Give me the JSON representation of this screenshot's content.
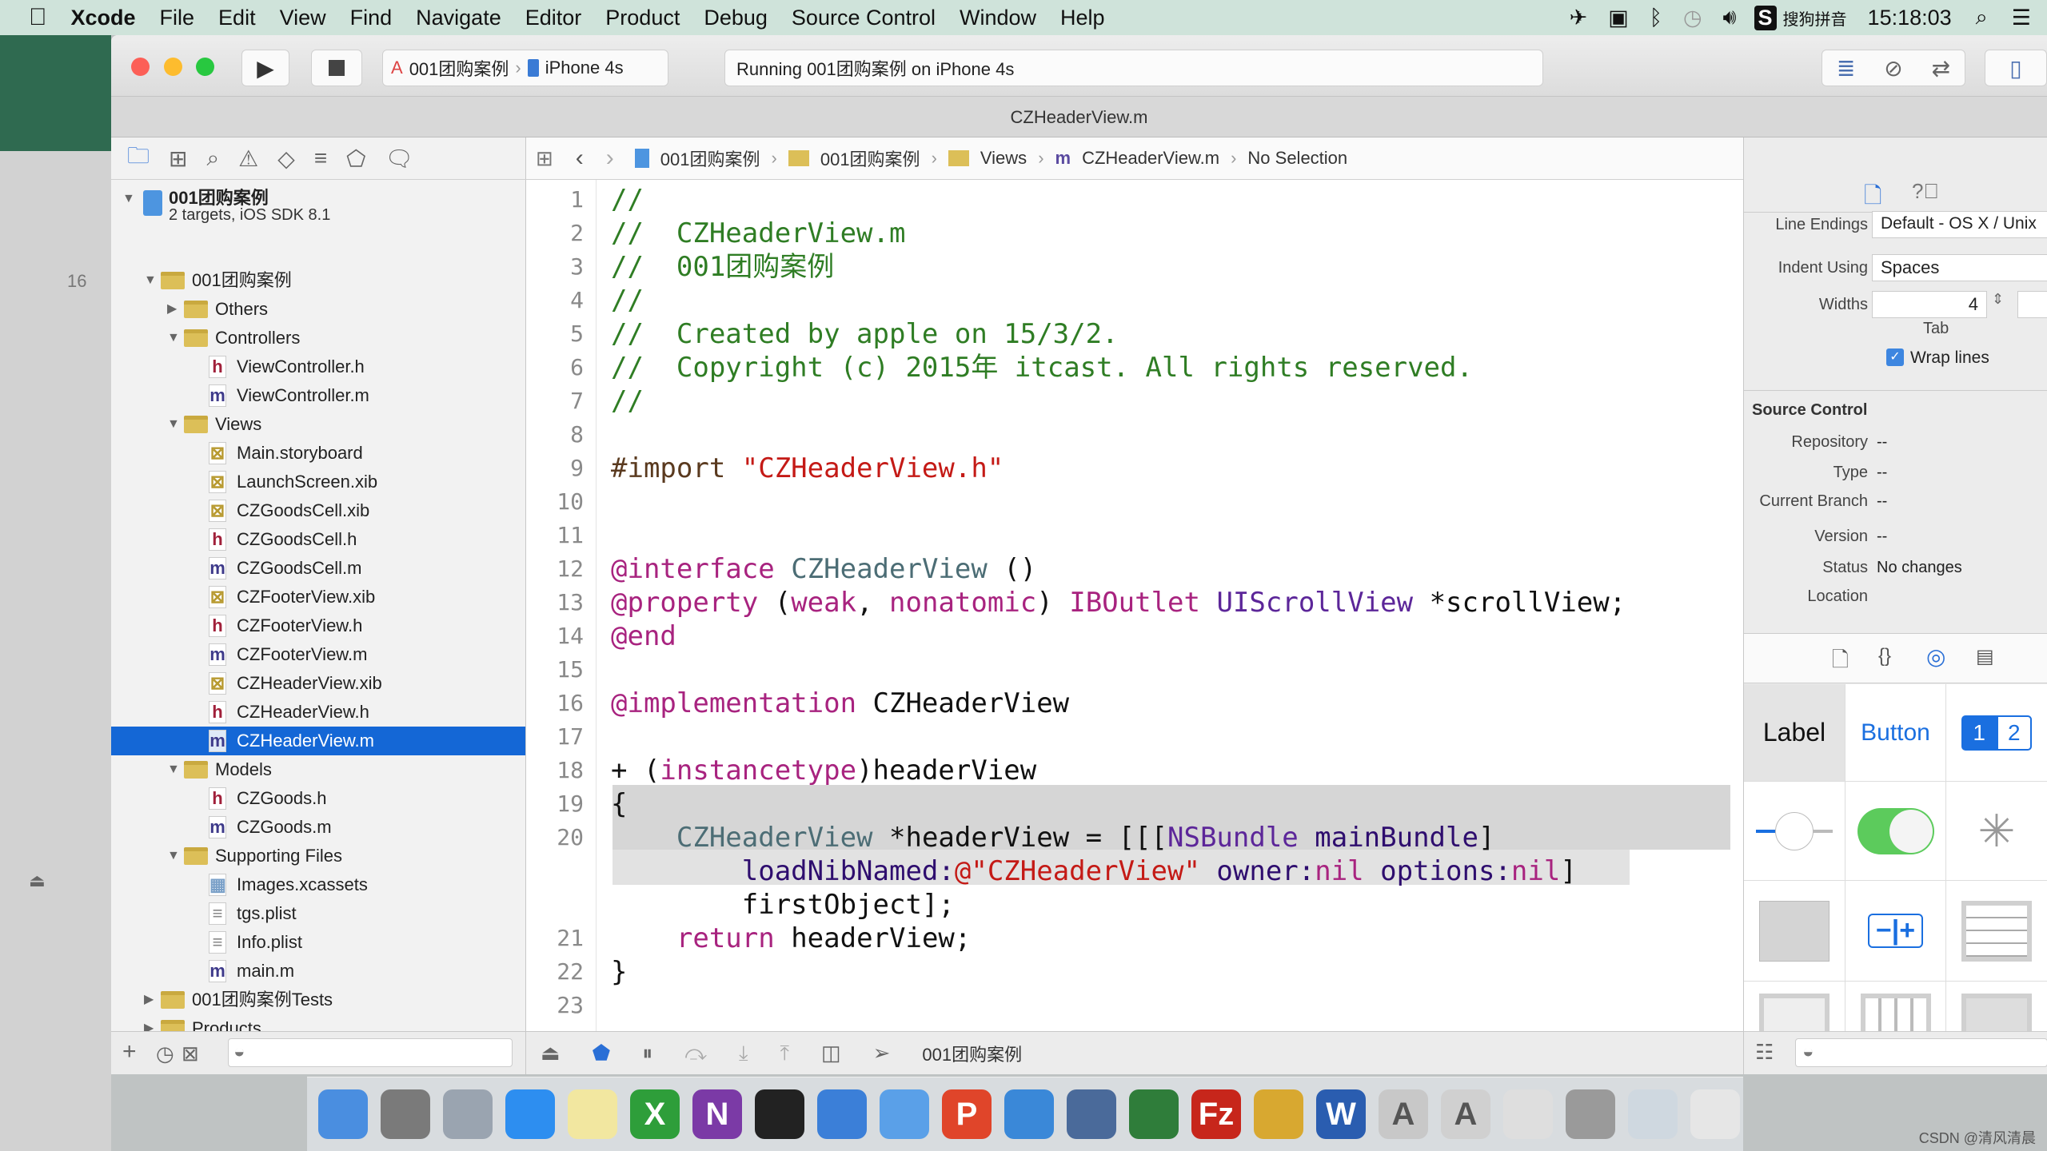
{
  "menubar": {
    "app": "Xcode",
    "items": [
      "File",
      "Edit",
      "View",
      "Find",
      "Navigate",
      "Editor",
      "Product",
      "Debug",
      "Source Control",
      "Window",
      "Help"
    ],
    "input_method": "搜狗拼音",
    "time": "15:18:03"
  },
  "toolbar": {
    "scheme": "001团购案例",
    "device": "iPhone 4s",
    "status": "Running 001团购案例 on iPhone 4s"
  },
  "tab_title": "CZHeaderView.m",
  "desktop_text": "16",
  "jumpbar": [
    "001团购案例",
    "001团购案例",
    "Views",
    "CZHeaderView.m",
    "No Selection"
  ],
  "navigator": {
    "project": {
      "name": "001团购案例",
      "subtitle": "2 targets, iOS SDK 8.1"
    },
    "items": [
      {
        "level": 1,
        "type": "folder",
        "open": true,
        "label": "001团购案例"
      },
      {
        "level": 2,
        "type": "folder",
        "open": false,
        "label": "Others"
      },
      {
        "level": 2,
        "type": "folder",
        "open": true,
        "label": "Controllers"
      },
      {
        "level": 3,
        "type": "h",
        "label": "ViewController.h"
      },
      {
        "level": 3,
        "type": "m",
        "label": "ViewController.m"
      },
      {
        "level": 2,
        "type": "folder",
        "open": true,
        "label": "Views"
      },
      {
        "level": 3,
        "type": "xib",
        "label": "Main.storyboard"
      },
      {
        "level": 3,
        "type": "xib",
        "label": "LaunchScreen.xib"
      },
      {
        "level": 3,
        "type": "xib",
        "label": "CZGoodsCell.xib"
      },
      {
        "level": 3,
        "type": "h",
        "label": "CZGoodsCell.h"
      },
      {
        "level": 3,
        "type": "m",
        "label": "CZGoodsCell.m"
      },
      {
        "level": 3,
        "type": "xib",
        "label": "CZFooterView.xib"
      },
      {
        "level": 3,
        "type": "h",
        "label": "CZFooterView.h"
      },
      {
        "level": 3,
        "type": "m",
        "label": "CZFooterView.m"
      },
      {
        "level": 3,
        "type": "xib",
        "label": "CZHeaderView.xib"
      },
      {
        "level": 3,
        "type": "h",
        "label": "CZHeaderView.h"
      },
      {
        "level": 3,
        "type": "m",
        "label": "CZHeaderView.m",
        "selected": true
      },
      {
        "level": 2,
        "type": "folder",
        "open": true,
        "label": "Models"
      },
      {
        "level": 3,
        "type": "h",
        "label": "CZGoods.h"
      },
      {
        "level": 3,
        "type": "m",
        "label": "CZGoods.m"
      },
      {
        "level": 2,
        "type": "folder",
        "open": true,
        "label": "Supporting Files"
      },
      {
        "level": 3,
        "type": "assets",
        "label": "Images.xcassets"
      },
      {
        "level": 3,
        "type": "plist",
        "label": "tgs.plist"
      },
      {
        "level": 3,
        "type": "plist",
        "label": "Info.plist"
      },
      {
        "level": 3,
        "type": "m",
        "label": "main.m"
      },
      {
        "level": 1,
        "type": "folder",
        "open": false,
        "label": "001团购案例Tests"
      },
      {
        "level": 1,
        "type": "folder",
        "open": false,
        "label": "Products"
      }
    ]
  },
  "code": {
    "colors": {
      "com": "#2f7d24",
      "kw": "#a8237f",
      "str": "#c41a16",
      "cls": "#4c6d75",
      "cls2": "#5c2699",
      "pre": "#5a3a1f",
      "meth": "#2e0d6e",
      "p": "#111111"
    },
    "lines": [
      {
        "num": "1",
        "tokens": [
          [
            "com",
            "//"
          ]
        ]
      },
      {
        "num": "2",
        "tokens": [
          [
            "com",
            "//  CZHeaderView.m"
          ]
        ]
      },
      {
        "num": "3",
        "tokens": [
          [
            "com",
            "//  001团购案例"
          ]
        ]
      },
      {
        "num": "4",
        "tokens": [
          [
            "com",
            "//"
          ]
        ]
      },
      {
        "num": "5",
        "tokens": [
          [
            "com",
            "//  Created by apple on 15/3/2."
          ]
        ]
      },
      {
        "num": "6",
        "tokens": [
          [
            "com",
            "//  Copyright (c) 2015年 itcast. All rights reserved."
          ]
        ]
      },
      {
        "num": "7",
        "tokens": [
          [
            "com",
            "//"
          ]
        ]
      },
      {
        "num": "8",
        "tokens": []
      },
      {
        "num": "9",
        "tokens": [
          [
            "pre",
            "#import "
          ],
          [
            "str",
            "\"CZHeaderView.h\""
          ]
        ]
      },
      {
        "num": "10",
        "tokens": []
      },
      {
        "num": "11",
        "tokens": []
      },
      {
        "num": "12",
        "tokens": [
          [
            "kw",
            "@interface"
          ],
          [
            "p",
            " "
          ],
          [
            "cls",
            "CZHeaderView"
          ],
          [
            "p",
            " ()"
          ]
        ]
      },
      {
        "num": "13",
        "tokens": [
          [
            "kw",
            "@property"
          ],
          [
            "p",
            " ("
          ],
          [
            "kw",
            "weak"
          ],
          [
            "p",
            ", "
          ],
          [
            "kw",
            "nonatomic"
          ],
          [
            "p",
            ") "
          ],
          [
            "kw",
            "IBOutlet"
          ],
          [
            "p",
            " "
          ],
          [
            "cls2",
            "UIScrollView"
          ],
          [
            "p",
            " *scrollView;"
          ]
        ]
      },
      {
        "num": "14",
        "tokens": [
          [
            "kw",
            "@end"
          ]
        ]
      },
      {
        "num": "15",
        "tokens": []
      },
      {
        "num": "16",
        "tokens": [
          [
            "kw",
            "@implementation"
          ],
          [
            "p",
            " CZHeaderView"
          ]
        ]
      },
      {
        "num": "17",
        "tokens": []
      },
      {
        "num": "18",
        "tokens": [
          [
            "p",
            "+ ("
          ],
          [
            "kw",
            "instancetype"
          ],
          [
            "p",
            ")headerView"
          ]
        ]
      },
      {
        "num": "19",
        "tokens": [
          [
            "p",
            "{"
          ]
        ]
      },
      {
        "num": "20",
        "tokens": [
          [
            "p",
            "    "
          ],
          [
            "cls",
            "CZHeaderView"
          ],
          [
            "p",
            " *headerView = [[["
          ],
          [
            "cls2",
            "NSBundle"
          ],
          [
            "p",
            " "
          ],
          [
            "meth",
            "mainBundle"
          ],
          [
            "p",
            "]"
          ]
        ]
      },
      {
        "num": "",
        "tokens": [
          [
            "p",
            "        "
          ],
          [
            "meth",
            "loadNibNamed:"
          ],
          [
            "str",
            "@\"CZHeaderView\""
          ],
          [
            "p",
            " "
          ],
          [
            "meth",
            "owner:"
          ],
          [
            "kw",
            "nil"
          ],
          [
            "p",
            " "
          ],
          [
            "meth",
            "options:"
          ],
          [
            "kw",
            "nil"
          ],
          [
            "p",
            "]"
          ]
        ]
      },
      {
        "num": "",
        "tokens": [
          [
            "p",
            "        firstObject];"
          ]
        ]
      },
      {
        "num": "21",
        "tokens": [
          [
            "p",
            "    "
          ],
          [
            "kw",
            "return"
          ],
          [
            "p",
            " headerView;"
          ]
        ]
      },
      {
        "num": "22",
        "tokens": [
          [
            "p",
            "}"
          ]
        ]
      },
      {
        "num": "23",
        "tokens": []
      }
    ]
  },
  "debugbar": {
    "target": "001团购案例"
  },
  "inspector": {
    "line_endings_label": "Line Endings",
    "line_endings": "Default - OS X / Unix",
    "indent_label": "Indent Using",
    "indent": "Spaces",
    "widths_label": "Widths",
    "tab_width": "4",
    "tab_label": "Tab",
    "wrap_label": "Wrap lines",
    "wrap_checked": true,
    "source_control": "Source Control",
    "rows": [
      {
        "label": "Repository",
        "value": "--"
      },
      {
        "label": "Type",
        "value": "--"
      },
      {
        "label": "Current Branch",
        "value": "--"
      },
      {
        "label": "Version",
        "value": "--"
      },
      {
        "label": "Status",
        "value": "No changes"
      },
      {
        "label": "Location",
        "value": ""
      }
    ]
  },
  "library": {
    "label": "Label",
    "button": "Button",
    "seg1": "1",
    "seg2": "2",
    "accent": "#1a6fe0",
    "switch_on": "#5ccb5c"
  },
  "dock": [
    {
      "icon": "finder-icon",
      "color": "#4a8ee0",
      "glyph": ""
    },
    {
      "icon": "system-preferences-icon",
      "color": "#7a7a7a",
      "glyph": ""
    },
    {
      "icon": "launchpad-icon",
      "color": "#9aa4b0",
      "glyph": ""
    },
    {
      "icon": "safari-icon",
      "color": "#2d8ef0",
      "glyph": ""
    },
    {
      "icon": "notes-icon",
      "color": "#f2e7a0",
      "glyph": ""
    },
    {
      "icon": "x-icon",
      "color": "#2e9e3a",
      "glyph": "X"
    },
    {
      "icon": "onenote-icon",
      "color": "#7b3aa6",
      "glyph": "N"
    },
    {
      "icon": "terminal-icon",
      "color": "#222222",
      "glyph": ""
    },
    {
      "icon": "xcode-icon",
      "color": "#3b7fd8",
      "glyph": ""
    },
    {
      "icon": "folder-icon",
      "color": "#5aa0e8",
      "glyph": ""
    },
    {
      "icon": "pointer-icon",
      "color": "#e0452a",
      "glyph": "P"
    },
    {
      "icon": "scissors-icon",
      "color": "#3a88d8",
      "glyph": ""
    },
    {
      "icon": "clapboard-icon",
      "color": "#4a6a9a",
      "glyph": ""
    },
    {
      "icon": "network-icon",
      "color": "#2f7d3a",
      "glyph": ""
    },
    {
      "icon": "filezilla-icon",
      "color": "#c7261b",
      "glyph": "Fz"
    },
    {
      "icon": "tool-icon",
      "color": "#d8a830",
      "glyph": ""
    },
    {
      "icon": "word-icon",
      "color": "#2a5db0",
      "glyph": "W"
    },
    {
      "icon": "app-store-icon",
      "color": "#c8c8c8",
      "glyph": "A"
    },
    {
      "icon": "preview-icon",
      "color": "#d0d0d0",
      "glyph": "A"
    },
    {
      "icon": "mail-icon",
      "color": "#dedede",
      "glyph": ""
    },
    {
      "icon": "printer-icon",
      "color": "#9a9a9a",
      "glyph": ""
    },
    {
      "icon": "downloads-icon",
      "color": "#cfd8e0",
      "glyph": ""
    },
    {
      "icon": "trash-icon",
      "color": "#e6e6e6",
      "glyph": ""
    }
  ],
  "watermark": "CSDN @清风清晨"
}
